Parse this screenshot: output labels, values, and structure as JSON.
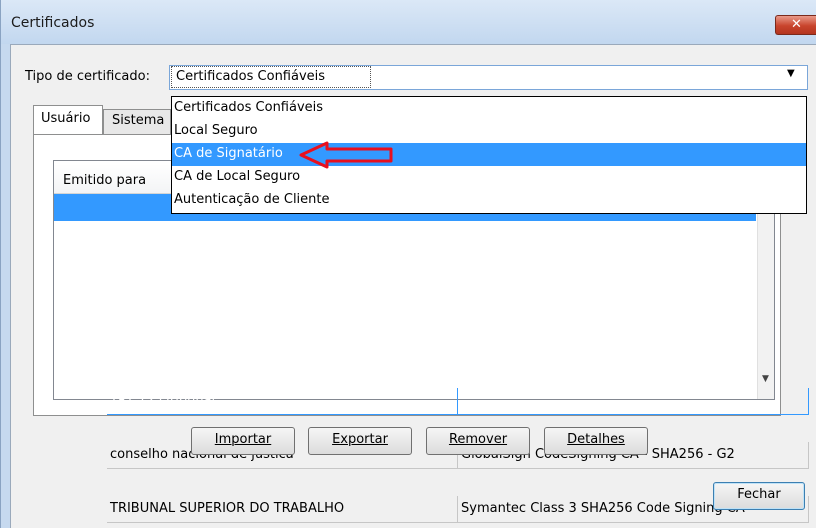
{
  "window": {
    "title": "Certificados",
    "close_label": "✕"
  },
  "type_selector": {
    "label": "Tipo de certificado:",
    "value": "Certificados Confiáveis"
  },
  "dropdown_options": [
    "Certificados Confiáveis",
    "Local Seguro",
    "CA de Signatário",
    "CA de Local Seguro",
    "Autenticação de Cliente"
  ],
  "highlighted_option": "CA de Signatário",
  "tabs": [
    {
      "label": "Usuário",
      "active": true
    },
    {
      "label": "Sistema",
      "active": false
    }
  ],
  "table": {
    "columns": [
      "Emitido para",
      ""
    ],
    "rows": [
      {
        "issued_to": "TRT 12 (Tribunal",
        "issued_by": "",
        "selected": true
      },
      {
        "issued_to": "conselho nacional de justica",
        "issued_by": "GlobalSign CodeSigning CA - SHA256 - G2",
        "selected": false
      },
      {
        "issued_to": "TRIBUNAL SUPERIOR DO TRABALHO",
        "issued_by": "Symantec Class 3 SHA256 Code Signing CA",
        "selected": false
      }
    ]
  },
  "buttons": {
    "import": "Importar",
    "export": "Exportar",
    "remove": "Remover",
    "details": "Detalhes",
    "close": "Fechar"
  },
  "colors": {
    "selection": "#3399ff",
    "annotation_arrow": "#e8101e"
  }
}
